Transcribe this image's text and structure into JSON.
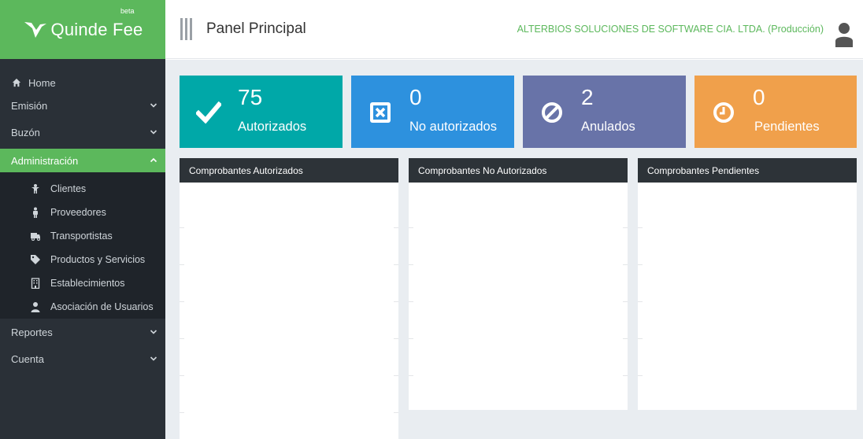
{
  "brand": {
    "name": "Quinde Fee",
    "badge": "beta",
    "color": "#5cb85c"
  },
  "sidebar": {
    "home": "Home",
    "items": [
      {
        "label": "Emisión"
      },
      {
        "label": "Buzón"
      },
      {
        "label": "Administración",
        "active": true
      }
    ],
    "submenu": [
      {
        "label": "Clientes",
        "icon": "child-icon"
      },
      {
        "label": "Proveedores",
        "icon": "male-icon"
      },
      {
        "label": "Transportistas",
        "icon": "truck-icon"
      },
      {
        "label": "Productos y Servicios",
        "icon": "tag-icon"
      },
      {
        "label": "Establecimientos",
        "icon": "building-icon"
      },
      {
        "label": "Asociación de Usuarios",
        "icon": "user-icon"
      }
    ],
    "items_after": [
      {
        "label": "Reportes"
      },
      {
        "label": "Cuenta"
      }
    ]
  },
  "header": {
    "title": "Panel Principal",
    "company": "ALTERBIOS SOLUCIONES DE SOFTWARE CIA. LTDA. (Producción)"
  },
  "cards": [
    {
      "value": "75",
      "label": "Autorizados",
      "color": "#00a8a8",
      "icon": "check-icon"
    },
    {
      "value": "0",
      "label": "No autorizados",
      "color": "#2d91de",
      "icon": "x-square-icon"
    },
    {
      "value": "2",
      "label": "Anulados",
      "color": "#6873a8",
      "icon": "ban-icon"
    },
    {
      "value": "0",
      "label": "Pendientes",
      "color": "#f0a04b",
      "icon": "clock-icon"
    }
  ],
  "panels": [
    {
      "title": "Comprobantes Autorizados"
    },
    {
      "title": "Comprobantes No Autorizados"
    },
    {
      "title": "Comprobantes Pendientes"
    }
  ]
}
